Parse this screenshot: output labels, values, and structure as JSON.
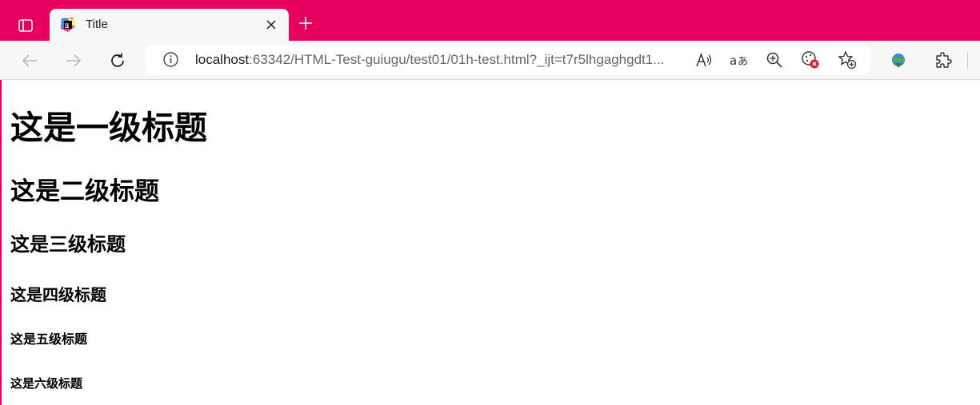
{
  "browser": {
    "tab": {
      "title": "Title",
      "favicon": "jetbrains-icon"
    },
    "address": {
      "host": "localhost",
      "rest": ":63342/HTML-Test-guiugu/test01/01h-test.html?_ijt=t7r5lhgaghgdt1..."
    },
    "icons": {
      "tab_actions": "tab-actions-icon",
      "close": "close-icon",
      "new_tab": "plus-icon",
      "back": "back-arrow-icon",
      "forward": "forward-arrow-icon",
      "refresh": "refresh-icon",
      "info": "info-icon",
      "read_aloud": "read-aloud-icon",
      "translate": "translate-icon",
      "zoom": "zoom-icon",
      "tracking": "tracking-prevention-icon",
      "favorite": "add-favorite-icon",
      "extension": "idm-extension-icon",
      "extensions": "extensions-icon"
    },
    "colors": {
      "tabbar": "#e8005f",
      "toolbar": "#f7f7f7"
    }
  },
  "page": {
    "headings": {
      "h1": "这是一级标题",
      "h2": "这是二级标题",
      "h3": "这是三级标题",
      "h4": "这是四级标题",
      "h5": "这是五级标题",
      "h6": "这是六级标题"
    }
  }
}
